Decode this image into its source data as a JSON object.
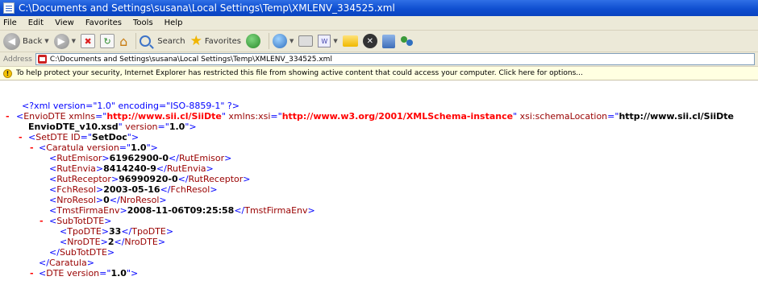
{
  "window": {
    "title": "C:\\Documents and Settings\\susana\\Local Settings\\Temp\\XMLENV_334525.xml"
  },
  "menu": {
    "file": "File",
    "edit": "Edit",
    "view": "View",
    "favorites": "Favorites",
    "tools": "Tools",
    "help": "Help"
  },
  "toolbar": {
    "back": "Back",
    "search": "Search",
    "favorites": "Favorites"
  },
  "address": {
    "label": "Address",
    "value": "C:\\Documents and Settings\\susana\\Local Settings\\Temp\\XMLENV_334525.xml"
  },
  "infobar": {
    "text": "To help protect your security, Internet Explorer has restricted this file from showing active content that could access your computer. Click here for options..."
  },
  "xml": {
    "declaration": "<?xml version=\"1.0\" encoding=\"ISO-8859-1\" ?>",
    "envio_open_tag": "EnvioDTE",
    "envio_xmlns_name": "xmlns",
    "envio_xmlns_value": "http://www.sii.cl/SiiDte",
    "envio_xsi_name": "xmlns:xsi",
    "envio_xsi_value": "http://www.w3.org/2001/XMLSchema-instance",
    "envio_schema_name": "xsi:schemaLocation",
    "envio_schema_value_1": "http://www.sii.cl/SiiDte",
    "envio_schema_value_2": "EnvioDTE_v10.xsd",
    "envio_version_name": "version",
    "envio_version_value": "1.0",
    "setdte_tag": "SetDTE",
    "setdte_id_name": "ID",
    "setdte_id_value": "SetDoc",
    "caratula_tag": "Caratula",
    "caratula_version_name": "version",
    "caratula_version_value": "1.0",
    "rut_emisor_tag": "RutEmisor",
    "rut_emisor_value": "61962900-0",
    "rut_envia_tag": "RutEnvia",
    "rut_envia_value": "8414240-9",
    "rut_receptor_tag": "RutReceptor",
    "rut_receptor_value": "96990920-0",
    "fch_resol_tag": "FchResol",
    "fch_resol_value": "2003-05-16",
    "nro_resol_tag": "NroResol",
    "nro_resol_value": "0",
    "tmst_tag": "TmstFirmaEnv",
    "tmst_value": "2008-11-06T09:25:58",
    "subtot_tag": "SubTotDTE",
    "tpo_tag": "TpoDTE",
    "tpo_value": "33",
    "nro_tag": "NroDTE",
    "nro_value": "2",
    "dte_tag": "DTE",
    "dte_version_name": "version",
    "dte_version_value": "1.0"
  }
}
